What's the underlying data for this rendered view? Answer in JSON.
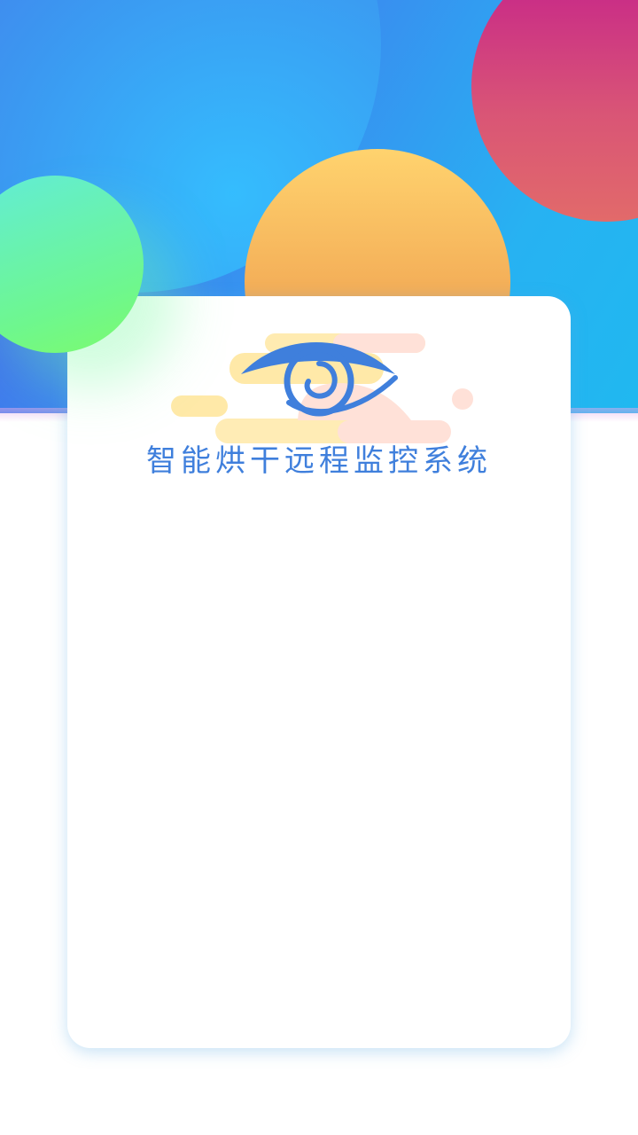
{
  "app": {
    "title": "智能烘干远程监控系统"
  },
  "logo": {
    "icon": "eye-swirl-logo",
    "colors": {
      "primary": "#3f7fdc",
      "cloud_yellow": "#ffe9a8",
      "cloud_peach": "#ffe1d8"
    }
  },
  "theme": {
    "header_gradient": [
      "#4a5fe6",
      "#20b8f0"
    ],
    "circle_magenta": "#c41f8c",
    "circle_orange": "#f2a955",
    "circle_green": "#6ef78e",
    "card_background": "#ffffff"
  }
}
